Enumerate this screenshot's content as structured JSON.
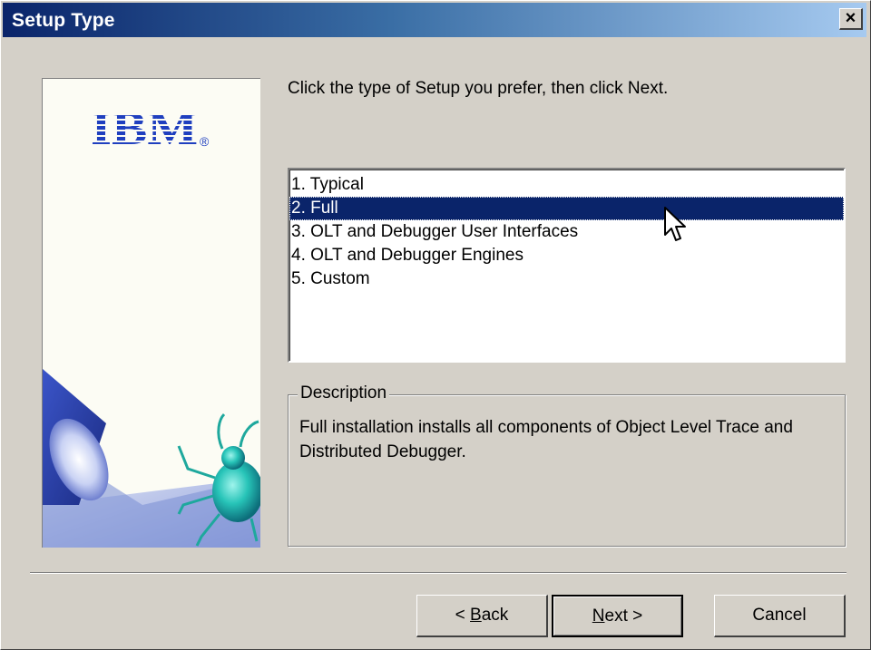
{
  "window": {
    "title": "Setup Type",
    "close_label": "×"
  },
  "logo": {
    "text": "IBM",
    "registered": "®"
  },
  "prompt": "Click the type of Setup you prefer, then click Next.",
  "setup_types": [
    {
      "label": "1. Typical",
      "selected": false
    },
    {
      "label": "2. Full",
      "selected": true
    },
    {
      "label": "3. OLT and  Debugger User Interfaces",
      "selected": false
    },
    {
      "label": "4. OLT and Debugger Engines",
      "selected": false
    },
    {
      "label": "5. Custom",
      "selected": false
    }
  ],
  "description": {
    "legend": "Description",
    "text": "Full installation installs all components of Object Level Trace and Distributed Debugger."
  },
  "buttons": {
    "back_prefix": "< ",
    "back_mnemonic": "B",
    "back_rest": "ack",
    "next_mnemonic": "N",
    "next_rest": "ext >",
    "cancel": "Cancel"
  },
  "colors": {
    "selection": "#0a246a",
    "ibm_blue": "#1f3fbf"
  }
}
